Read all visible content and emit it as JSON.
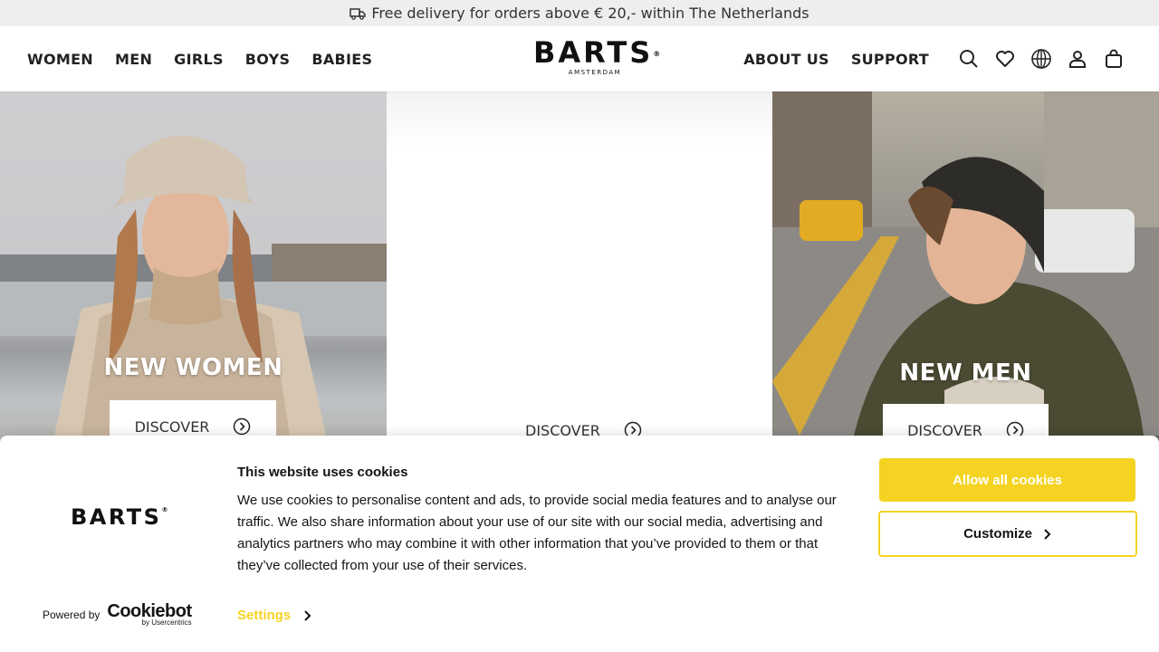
{
  "announcement": {
    "text": "Free delivery for orders above € 20,- within The Netherlands",
    "icon": "truck-icon"
  },
  "header": {
    "nav_left": [
      "WOMEN",
      "MEN",
      "GIRLS",
      "BOYS",
      "BABIES"
    ],
    "nav_right": [
      "ABOUT US",
      "SUPPORT"
    ],
    "logo": {
      "word": "BARTS",
      "sub": "AMSTERDAM",
      "reg": "®"
    },
    "icons": [
      "search-icon",
      "heart-icon",
      "globe-icon",
      "user-icon",
      "bag-icon"
    ]
  },
  "hero": {
    "women": {
      "title": "NEW WOMEN",
      "cta": "DISCOVER"
    },
    "center": {
      "cta": "DISCOVER"
    },
    "men": {
      "title": "NEW MEN",
      "cta": "DISCOVER"
    }
  },
  "cookie_banner": {
    "logo": "BARTS",
    "logo_reg": "®",
    "title": "This website uses cookies",
    "body": "We use cookies to personalise content and ads, to provide social media features and to analyse our traffic. We also share information about your use of our site with our social media, advertising and analytics partners who may combine it with other information that you’ve provided to them or that they’ve collected from your use of their services.",
    "allow_label": "Allow all cookies",
    "customize_label": "Customize",
    "powered_by": "Powered by",
    "cookiebot_main": "Cookiebot",
    "cookiebot_sub": "by Usercentrics",
    "settings_label": "Settings"
  },
  "colors": {
    "accent": "#f5d322",
    "topbar_bg": "#eeeeee",
    "text": "#222222"
  }
}
